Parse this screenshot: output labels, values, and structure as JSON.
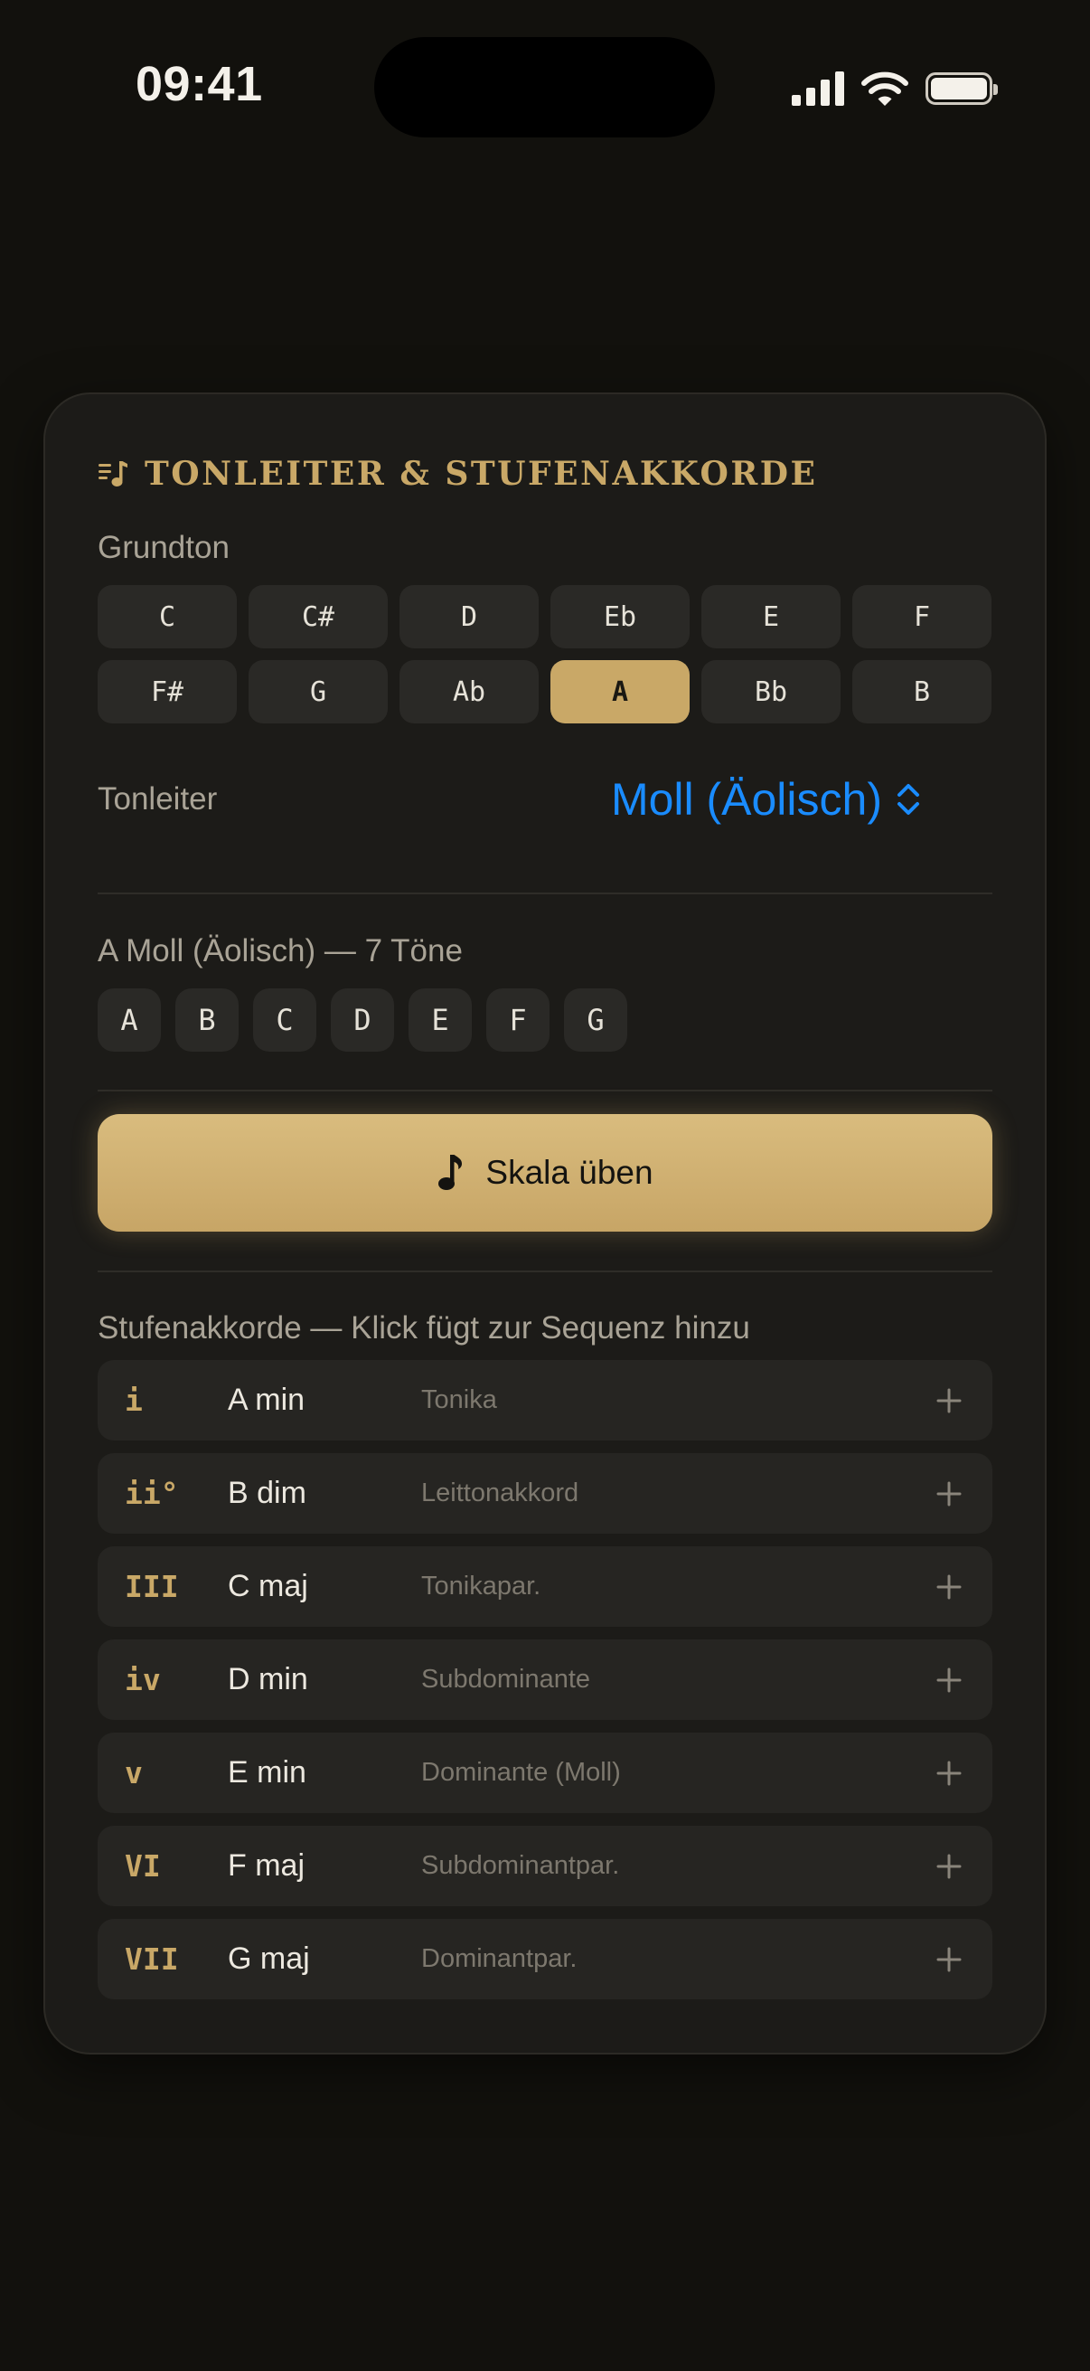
{
  "status_bar": {
    "time": "09:41"
  },
  "header": {
    "title": "TONLEITER & STUFENAKKORDE",
    "icon": "music-list-icon"
  },
  "root": {
    "label": "Grundton",
    "keys": [
      "C",
      "C#",
      "D",
      "Eb",
      "E",
      "F",
      "F#",
      "G",
      "Ab",
      "A",
      "Bb",
      "B"
    ],
    "selected": "A"
  },
  "scale": {
    "label": "Tonleiter",
    "selected": "Moll (Äolisch)"
  },
  "notes_section": {
    "summary": "A Moll (Äolisch) — 7 Töne",
    "notes": [
      "A",
      "B",
      "C",
      "D",
      "E",
      "F",
      "G"
    ]
  },
  "practice": {
    "label": "Skala üben",
    "icon": "music-note-icon"
  },
  "chords": {
    "label": "Stufenakkorde — Klick fügt zur Sequenz hinzu",
    "items": [
      {
        "roman": "i",
        "name": "A min",
        "function": "Tonika"
      },
      {
        "roman": "ii°",
        "name": "B dim",
        "function": "Leittonakkord"
      },
      {
        "roman": "III",
        "name": "C maj",
        "function": "Tonikapar."
      },
      {
        "roman": "iv",
        "name": "D min",
        "function": "Subdominante"
      },
      {
        "roman": "v",
        "name": "E min",
        "function": "Dominante (Moll)"
      },
      {
        "roman": "VI",
        "name": "F maj",
        "function": "Subdominantpar."
      },
      {
        "roman": "VII",
        "name": "G maj",
        "function": "Dominantpar."
      }
    ]
  },
  "colors": {
    "accent_gold": "#c9a867",
    "link_blue": "#1a8cff",
    "background": "#12110d",
    "card": "#1c1b18"
  }
}
